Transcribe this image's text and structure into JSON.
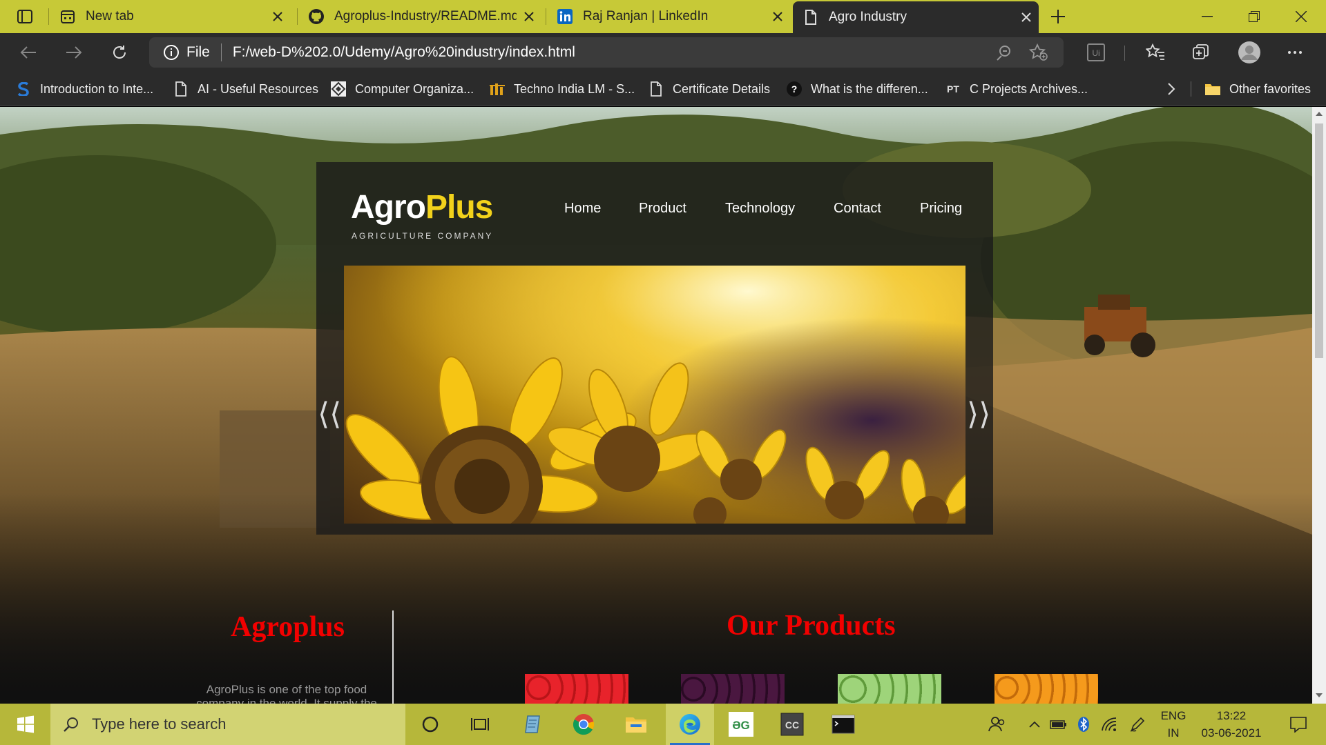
{
  "browser": {
    "tabs": [
      {
        "label": "New tab",
        "icon": "new-tab-icon"
      },
      {
        "label": "Agroplus-Industry/README.md",
        "icon": "github-icon"
      },
      {
        "label": "Raj Ranjan | LinkedIn",
        "icon": "linkedin-icon"
      },
      {
        "label": "Agro Industry",
        "icon": "page-icon",
        "active": true
      }
    ],
    "address": {
      "scheme_label": "File",
      "url": "F:/web-D%202.0/Udemy/Agro%20industry/index.html"
    },
    "favorites": [
      {
        "label": "Introduction to Inte...",
        "icon": "scaler-icon"
      },
      {
        "label": "AI - Useful Resources",
        "icon": "page-icon"
      },
      {
        "label": "Computer Organiza...",
        "icon": "site-icon"
      },
      {
        "label": "Techno India LM - S...",
        "icon": "techno-icon"
      },
      {
        "label": "Certificate Details",
        "icon": "page-icon"
      },
      {
        "label": "What is the differen...",
        "icon": "question-icon"
      },
      {
        "label": "C Projects Archives...",
        "icon": "pt-icon"
      }
    ],
    "other_favorites_label": "Other favorites",
    "colors": {
      "titlebar": "#c7c937",
      "chrome": "#2b2b2b"
    }
  },
  "site": {
    "logo": {
      "part1": "Agro",
      "part2": "Plus",
      "tagline": "AGRICULTURE COMPANY"
    },
    "nav": [
      "Home",
      "Product",
      "Technology",
      "Contact",
      "Pricing"
    ],
    "slider": {
      "prev_label": "⟨⟨",
      "next_label": "⟩⟩"
    },
    "about": {
      "heading": "Agroplus",
      "text": "AgroPlus is one of the top food company in the world. It supply the"
    },
    "products": {
      "heading": "Our Products",
      "items": [
        "tomatoes",
        "eggplants",
        "cabbages",
        "oranges"
      ]
    },
    "colors": {
      "accent_red": "#f20000",
      "logo_yellow": "#f2d21b"
    }
  },
  "taskbar": {
    "search_placeholder": "Type here to search",
    "language_line1": "ENG",
    "language_line2": "IN",
    "time": "13:22",
    "date": "03-06-2021",
    "apps": [
      "cortana-icon",
      "task-view-icon",
      "notepad-icon",
      "chrome-icon",
      "file-explorer-icon",
      "edge-icon",
      "geeksforgeeks-icon",
      "codeblocks-icon",
      "terminal-icon"
    ]
  }
}
